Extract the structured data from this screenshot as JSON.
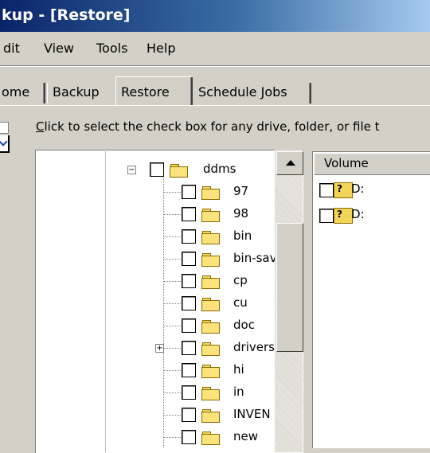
{
  "window": {
    "title": "kup - [Restore]"
  },
  "menu": [
    "dit",
    "View",
    "Tools",
    "Help"
  ],
  "tabs": [
    "ome",
    "Backup",
    "Restore",
    "Schedule Jobs"
  ],
  "instruction": {
    "accel": "C",
    "rest": "lick to select the check box for any drive, folder, or file t"
  },
  "tree": {
    "root": "ddms",
    "items": [
      "97",
      "98",
      "bin",
      "bin-sav",
      "cp",
      "cu",
      "doc",
      "drivers",
      "hi",
      "in",
      "INVEN",
      "new"
    ]
  },
  "volume_pane": {
    "header": "Volume",
    "rows": [
      "D:",
      "D:"
    ]
  }
}
